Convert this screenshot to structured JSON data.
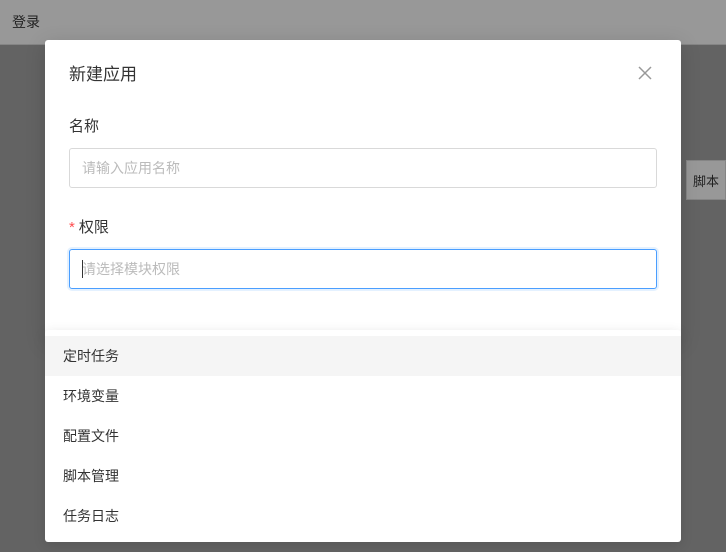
{
  "background": {
    "header_text": "登录",
    "right_tab": "脚本"
  },
  "modal": {
    "title": "新建应用",
    "fields": {
      "name": {
        "label": "名称",
        "placeholder": "请输入应用名称"
      },
      "permission": {
        "label": "权限",
        "placeholder": "请选择模块权限",
        "required_mark": "*"
      }
    }
  },
  "dropdown": {
    "options": [
      "定时任务",
      "环境变量",
      "配置文件",
      "脚本管理",
      "任务日志"
    ]
  }
}
